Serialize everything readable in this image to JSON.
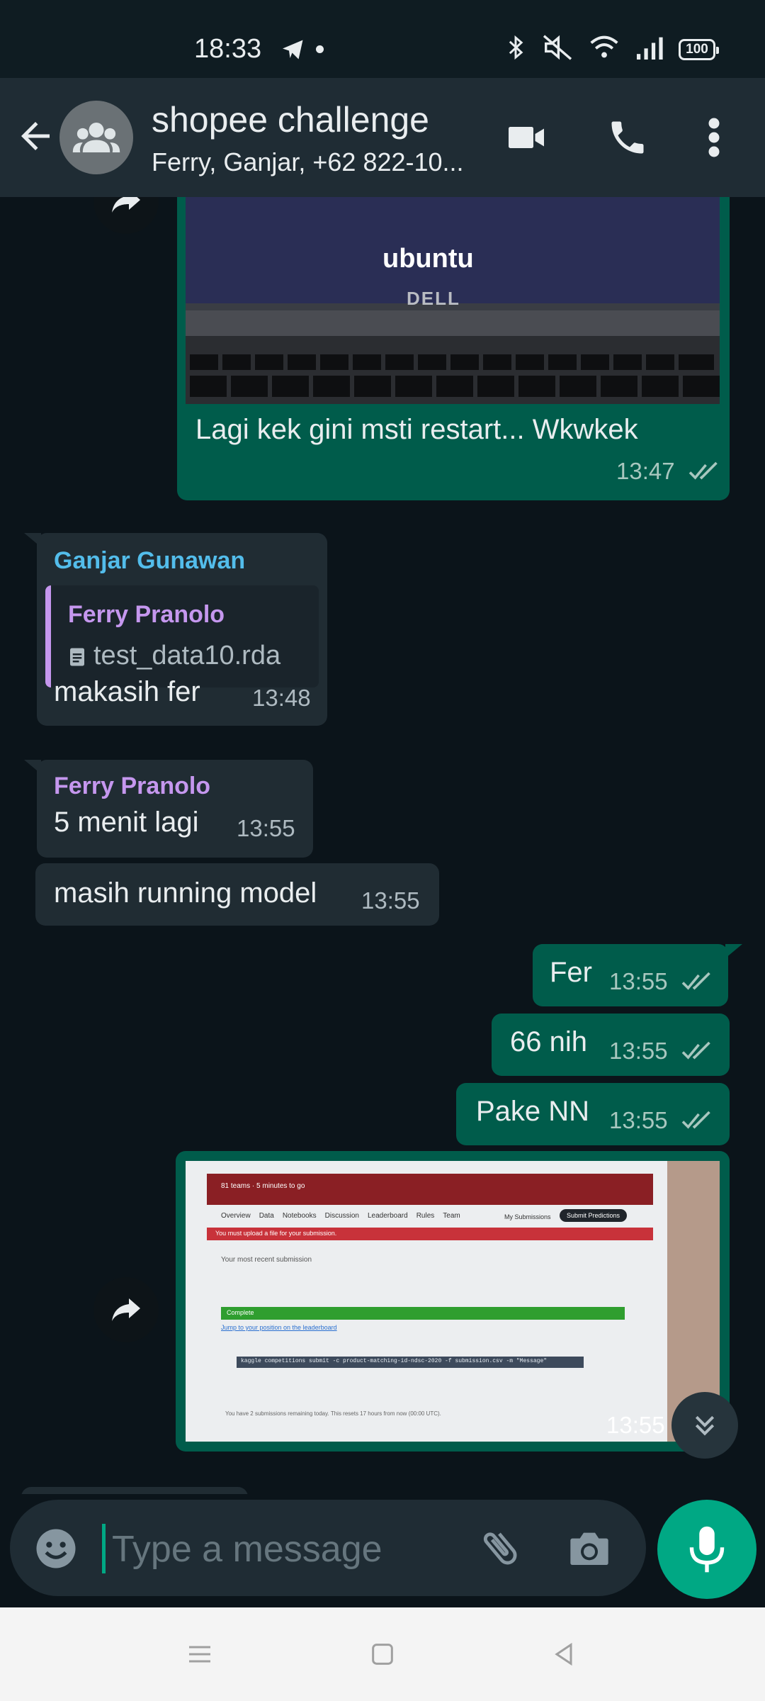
{
  "status_bar": {
    "time": "18:33",
    "battery": "100",
    "icons": [
      "telegram-icon",
      "bluetooth-icon",
      "mute-icon",
      "wifi-icon",
      "signal-icon",
      "battery-icon"
    ]
  },
  "header": {
    "title": "shopee challenge",
    "members": "Ferry, Ganjar, +62 822-10..."
  },
  "messages": [
    {
      "id": "m1",
      "type": "outgoing-image",
      "image_caption_brand": "ubuntu",
      "laptop_brand": "DELL",
      "text": "Lagi kek gini msti restart... Wkwkek",
      "time": "13:47"
    },
    {
      "id": "m2",
      "type": "incoming-reply",
      "sender": "Ganjar Gunawan",
      "quoted_sender": "Ferry Pranolo",
      "quoted_file": "test_data10.rda",
      "text": "makasih fer",
      "time": "13:48"
    },
    {
      "id": "m3",
      "type": "incoming",
      "sender": "Ferry Pranolo",
      "text": "5 menit lagi",
      "time": "13:55"
    },
    {
      "id": "m4",
      "type": "incoming",
      "text": "masih running model",
      "time": "13:55"
    },
    {
      "id": "m5",
      "type": "outgoing",
      "text": "Fer",
      "time": "13:55"
    },
    {
      "id": "m6",
      "type": "outgoing",
      "text": "66 nih",
      "time": "13:55"
    },
    {
      "id": "m7",
      "type": "outgoing",
      "text": "Pake NN",
      "time": "13:55"
    },
    {
      "id": "m8",
      "type": "outgoing-image",
      "time": "13:55",
      "screen": {
        "teams": "81 teams · 5 minutes to go",
        "tabs": [
          "Overview",
          "Data",
          "Notebooks",
          "Discussion",
          "Leaderboard",
          "Rules",
          "Team"
        ],
        "my_submissions": "My Submissions",
        "submit_button": "Submit Predictions",
        "error": "You must upload a file for your submission.",
        "section": "Your most recent submission",
        "status": "Complete",
        "jump_link": "Jump to your position on the leaderboard",
        "command": "kaggle competitions submit -c product-matching-id-ndsc-2020 -f submission.csv -m \"Message\"",
        "remaining": "You have 2 submissions remaining today. This resets 17 hours from now (00:00 UTC)."
      }
    }
  ],
  "input": {
    "placeholder": "Type a message"
  },
  "colors": {
    "background": "#0b141a",
    "incoming": "#202c33",
    "outgoing": "#005c4b",
    "accent": "#00a884",
    "sender_teal": "#53bdeb",
    "sender_purple": "#c597ee"
  }
}
